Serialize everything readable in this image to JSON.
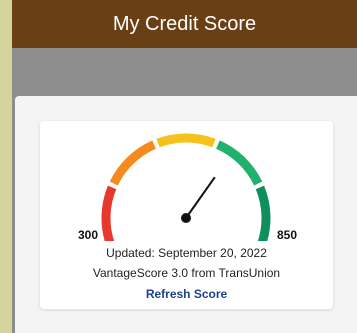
{
  "header": {
    "title": "My Credit Score"
  },
  "gauge": {
    "min_label": "300",
    "max_label": "850",
    "level": 0.66,
    "segment_colors": [
      "#e8372c",
      "#f58b1e",
      "#f5c21b",
      "#22b06e",
      "#0f8f5c"
    ]
  },
  "score_info": {
    "updated": "Updated: September 20, 2022",
    "source": "VantageScore 3.0 from TransUnion",
    "refresh_label": "Refresh Score"
  }
}
